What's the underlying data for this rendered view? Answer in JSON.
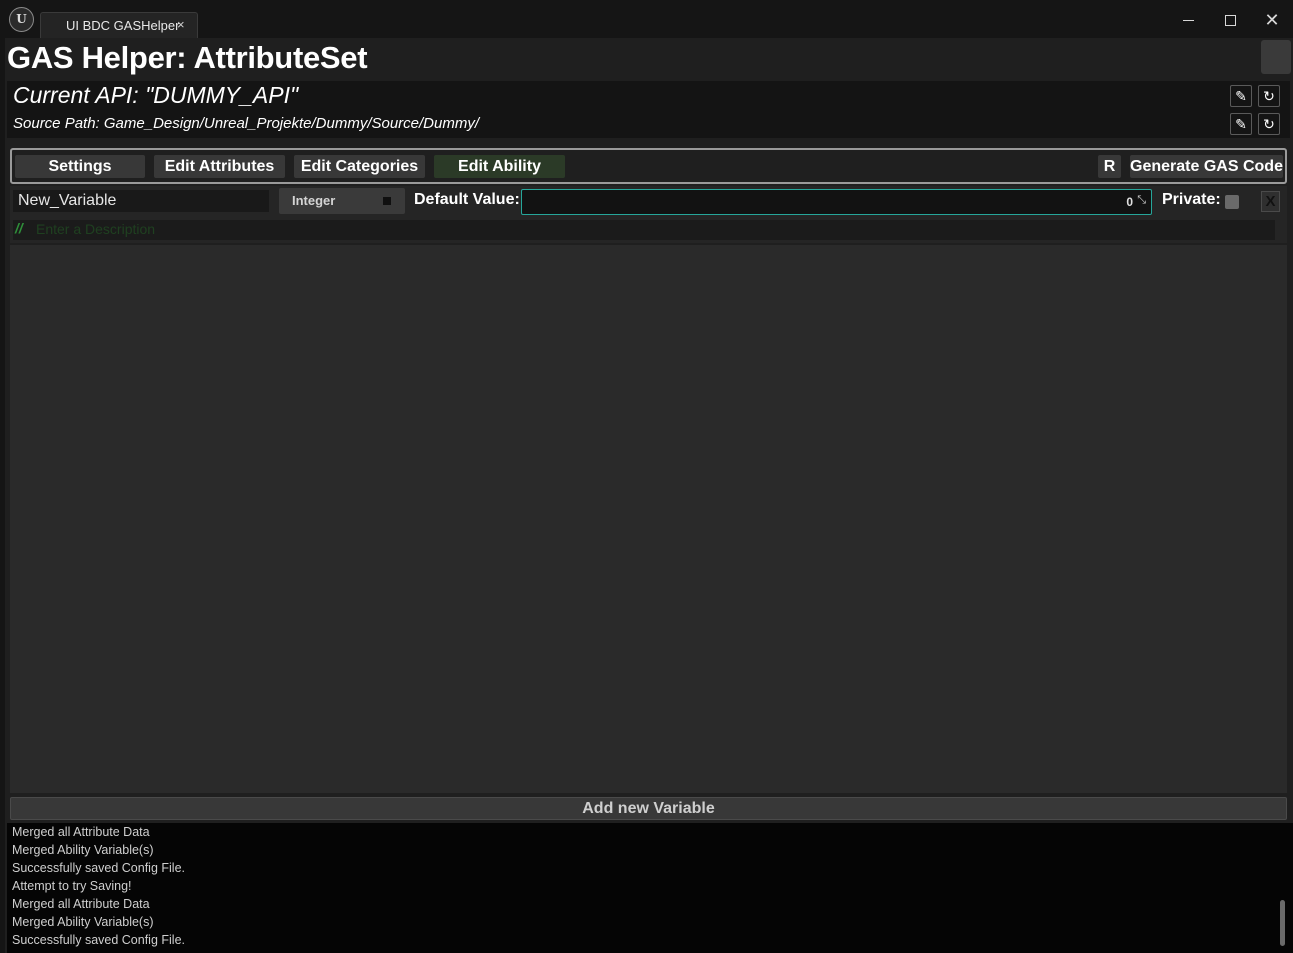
{
  "window": {
    "logo_text": "U",
    "tab_title": "UI BDC GASHelper",
    "tab_close": "×",
    "close_glyph": "✕"
  },
  "header": {
    "title": "GAS Helper: AttributeSet",
    "current_api": "Current API: \"DUMMY_API\"",
    "source_path": "Source Path: Game_Design/Unreal_Projekte/Dummy/Source/Dummy/",
    "edit_glyph": "✎",
    "refresh_glyph": "↻"
  },
  "toolbar": {
    "settings": "Settings",
    "edit_attributes": "Edit Attributes",
    "edit_categories": "Edit Categories",
    "edit_ability": "Edit Ability",
    "reset": "R",
    "generate": "Generate GAS Code"
  },
  "variable": {
    "name": "New_Variable",
    "type": "Integer",
    "default_value_label": "Default Value:",
    "default_value": "0",
    "private_label": "Private:",
    "private_checked": false,
    "delete_label": "X",
    "comment_prefix": "//",
    "description_placeholder": "Enter a Description"
  },
  "footer": {
    "add_variable": "Add new Variable"
  },
  "log": [
    "Merged all Attribute Data",
    "Merged Ability Variable(s)",
    "Successfully saved Config File.",
    "Attempt to try Saving!",
    "Merged all Attribute Data",
    "Merged Ability Variable(s)",
    "Successfully saved Config File."
  ],
  "colors": {
    "accent_teal": "#26a69a",
    "active_tab_green": "#2b3a27",
    "comment_green": "#2f8f3a"
  }
}
